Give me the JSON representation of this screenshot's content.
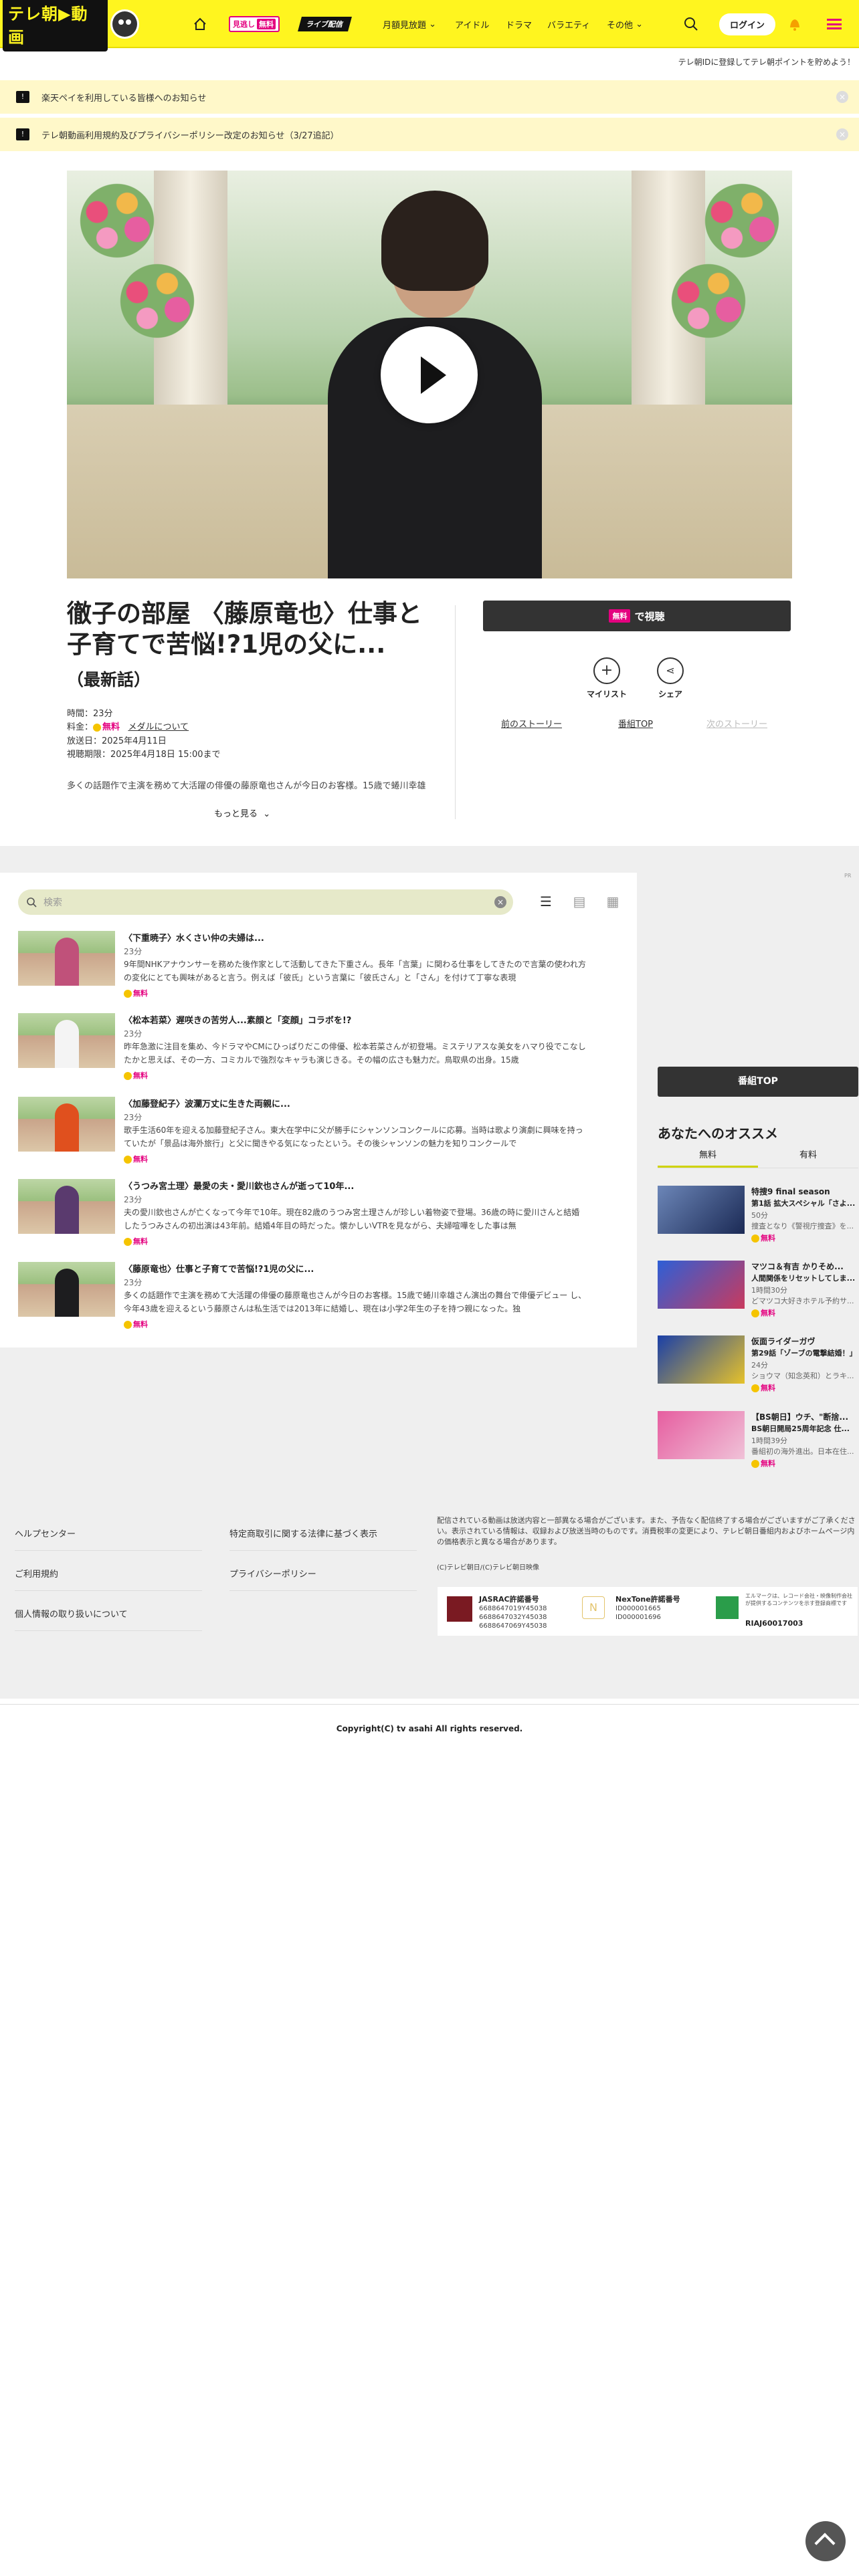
{
  "header": {
    "logo_text": "テレ朝▶動画",
    "nav": {
      "free_badge_prefix": "見逃し",
      "free_badge": "無料",
      "live": "ライブ配信",
      "monthly": "月額見放題",
      "idol": "アイドル",
      "drama": "ドラマ",
      "variety": "バラエティ",
      "other": "その他"
    },
    "login": "ログイン",
    "promo": "テレ朝IDに登録してテレ朝ポイントを貯めよう！"
  },
  "notices": [
    "楽天ペイを利用している皆様へのお知らせ",
    "テレ朝動画利用規約及びプライバシーポリシー改定のお知らせ（3/27追記）"
  ],
  "program": {
    "title": "徹子の部屋 〈藤原竜也〉仕事と子育てで苦悩!?1児の父に...",
    "subtitle": "（最新話）",
    "duration": "時間：23分",
    "price_label": "料金：",
    "price_value": "無料",
    "price_link": "メダルについて",
    "aired": "放送日：2025年4月11日",
    "period": "視聴期限：2025年4月18日 15:00まで",
    "description": "多くの話題作で主演を務めて大活躍の俳優の藤原竜也さんが今日のお客様。15歳で蜷川幸雄",
    "more": "もっと見る",
    "watch_badge": "無料",
    "watch_label": "で視聴",
    "mylist": "マイリスト",
    "share": "シェア",
    "prev": "前のストーリー",
    "top": "番組TOP",
    "next": "次のストーリー"
  },
  "search": {
    "placeholder": "検索"
  },
  "ad_label": "PR",
  "episodes": [
    {
      "title": "〈下重暁子〉水くさい仲の夫婦は...",
      "duration": "23分",
      "desc": "9年間NHKアナウンサーを務めた後作家として活動してきた下重さん。長年「言葉」に関わる仕事をしてきたので言葉の使われ方の変化にとても興味があると言う。例えば「彼氏」という言葉に「彼氏さん」と「さん」を付けて丁寧な表現",
      "free": "無料",
      "color": "#c0517a"
    },
    {
      "title": "〈松本若菜〉遅咲きの苦労人...素顔と「変顔」コラボを!?",
      "duration": "23分",
      "desc": "昨年急激に注目を集め、今ドラマやCMにひっぱりだこの俳優、松本若菜さんが初登場。ミステリアスな美女をハマり役でこなしたかと思えば、その一方、コミカルで強烈なキャラも演じきる。その幅の広さも魅力だ。鳥取県の出身。15歳",
      "free": "無料",
      "color": "#f4f4f4"
    },
    {
      "title": "〈加藤登紀子〉波瀾万丈に生きた両親に...",
      "duration": "23分",
      "desc": "歌手生活60年を迎える加藤登紀子さん。東大在学中に父が勝手にシャンソンコンクールに応募。当時は歌より演劇に興味を持っていたが「景品は海外旅行」と父に聞きやる気になったという。その後シャンソンの魅力を知りコンクールで",
      "free": "無料",
      "color": "#e0501e"
    },
    {
      "title": "〈うつみ宮土理〉最愛の夫・愛川欽也さんが逝って10年...",
      "duration": "23分",
      "desc": "夫の愛川欽也さんが亡くなって今年で10年。現在82歳のうつみ宮土理さんが珍しい着物姿で登場。36歳の時に愛川さんと結婚したうつみさんの初出演は43年前。結婚4年目の時だった。懐かしいVTRを見ながら、夫婦喧嘩をした事は無",
      "free": "無料",
      "color": "#5a3a6e"
    },
    {
      "title": "〈藤原竜也〉仕事と子育てで苦悩!?1児の父に...",
      "duration": "23分",
      "desc": "多くの話題作で主演を務めて大活躍の俳優の藤原竜也さんが今日のお客様。15歳で蜷川幸雄さん演出の舞台で俳優デビュー し、今年43歳を迎えるという藤原さんは私生活では2013年に結婚し、現在は小学2年生の子を持つ親になった。独",
      "free": "無料",
      "color": "#1d1d1f"
    }
  ],
  "sidebar": {
    "program_top": "番組TOP",
    "rec_title": "あなたへのオススメ",
    "tab_free": "無料",
    "tab_paid": "有料",
    "items": [
      {
        "line1": "特捜9 final season",
        "line2": "第1話 拡大スペシャル「さよ...",
        "dur": "50分",
        "desc": "捜査となり《警視庁捜査》を...",
        "free": "無料"
      },
      {
        "line1": "マツコ＆有吉 かりそめ...",
        "line2": "人間関係をリセットしてしま...",
        "dur": "1時間30分",
        "desc": "どマツコ大好きホテル予約サ...",
        "free": "無料"
      },
      {
        "line1": "仮面ライダーガヴ",
        "line2": "第29話「ゾーブの電撃結婚！」",
        "dur": "24分",
        "desc": "ショウマ（知念英和）とラキ...",
        "free": "無料"
      },
      {
        "line1": "【BS朝日】ウチ、\"断捨...",
        "line2": "BS朝日開局25周年記念 仕...",
        "dur": "1時間39分",
        "desc": "番組初の海外進出。日本在住...",
        "free": "無料"
      }
    ]
  },
  "footer": {
    "help": "ヘルプセンター",
    "terms": "ご利用規約",
    "privacy_handling": "個人情報の取り扱いについて",
    "commerce": "特定商取引に関する法律に基づく表示",
    "privacy_policy": "プライバシーポリシー",
    "note": "配信されている動画は放送内容と一部異なる場合がございます。また、予告なく配信終了する場合がございますがご了承ください。表示されている情報は、収録および放送当時のものです。消費税率の変更により、テレビ朝日番組内およびホームページ内の価格表示と異なる場合があります。",
    "note2": "(C)テレビ朝日/(C)テレビ朝日映像",
    "jasrac_title": "JASRAC許諾番号",
    "jasrac_nums": "6688647019Y45038\n6688647032Y45038\n6688647069Y45038",
    "nextone_title": "NexTone許諾番号",
    "nextone_nums": "ID000001665\nID000001696",
    "lmark_text": "エルマークは、レコード会社・映像制作会社が提供するコンテンツを示す登録商標です",
    "lmark_num": "RIAJ60017003",
    "copyright": "Copyright(C) tv asahi All rights reserved."
  }
}
